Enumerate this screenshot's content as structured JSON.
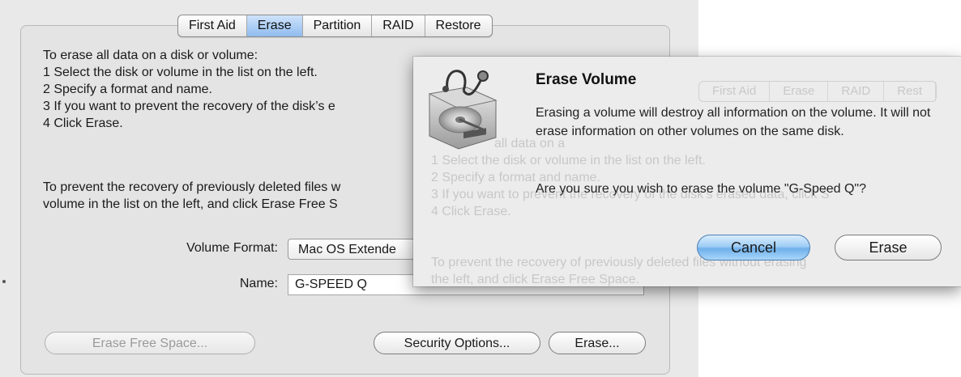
{
  "tabs": [
    {
      "label": "First Aid",
      "active": false
    },
    {
      "label": "Erase",
      "active": true
    },
    {
      "label": "Partition",
      "active": false
    },
    {
      "label": "RAID",
      "active": false
    },
    {
      "label": "Restore",
      "active": false
    }
  ],
  "instructions": {
    "line0": "To erase all data on a disk or volume:",
    "line1": "1 Select the disk or volume in the list on the left.",
    "line2": "2 Specify a format and name.",
    "line3": "3 If you want to prevent the recovery of the disk’s e",
    "line4": "4 Click Erase."
  },
  "free_space_note": {
    "line1": "To prevent the recovery of previously deleted files w",
    "line2": "volume in the list on the left, and click Erase Free S"
  },
  "form": {
    "volume_format_label": "Volume Format:",
    "volume_format_value": "Mac OS Extende",
    "name_label": "Name:",
    "name_value": "G-SPEED Q"
  },
  "buttons": {
    "erase_free_space": "Erase Free Space...",
    "security_options": "Security Options...",
    "erase": "Erase..."
  },
  "dialog": {
    "title": "Erase Volume",
    "message": "Erasing a volume will destroy all information on the volume. It will not erase information on other volumes on the same disk.",
    "question": "Are you sure you wish to erase the volume \"G-Speed Q\"?",
    "cancel_label": "Cancel",
    "erase_label": "Erase",
    "icon": "disk-utility-stethoscope-icon",
    "ghost": {
      "tabs": [
        "First Aid",
        "Erase",
        "RAID",
        "Rest"
      ],
      "line0": "all data on a",
      "line1": "1 Select the disk or volume in the list on the left.",
      "line2": "2 Specify a format and name.",
      "line3": "3 If you want to prevent the recovery of the disk’s erased data, click S",
      "line4": "4 Click Erase.",
      "line5": "To prevent the recovery of previously deleted files without erasing",
      "line6": "the left, and click Erase Free Space."
    }
  },
  "colors": {
    "active_tab": "#8fbcef",
    "default_button": "#6fb0ea"
  }
}
